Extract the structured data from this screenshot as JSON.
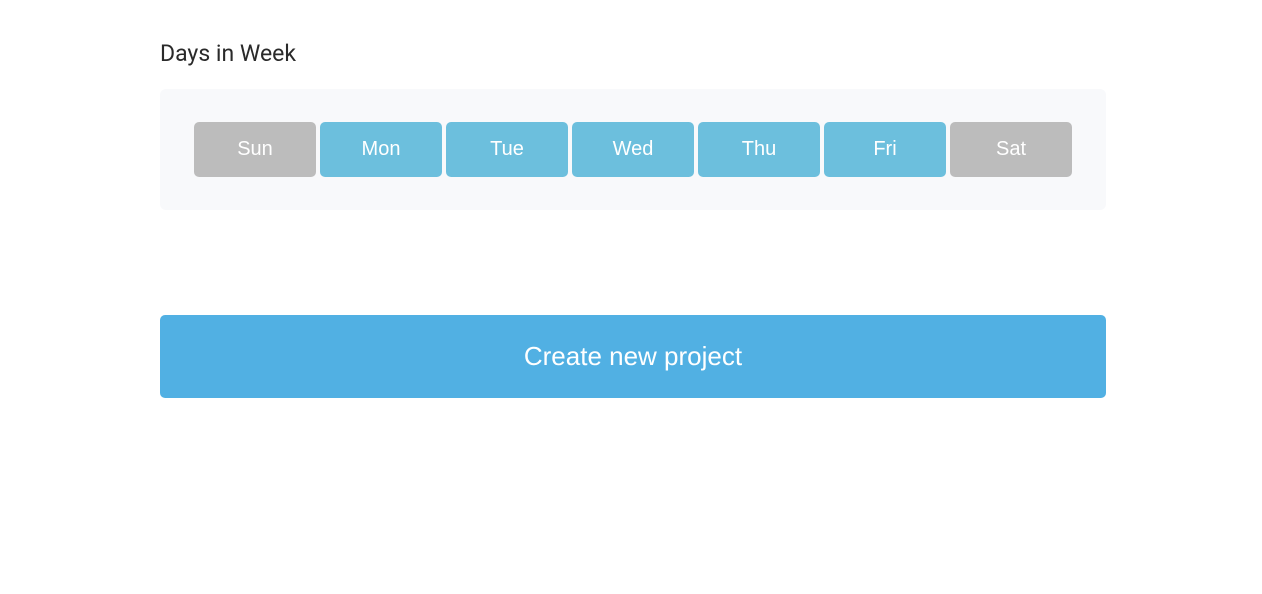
{
  "section": {
    "title": "Days in Week",
    "days": [
      {
        "label": "Sun",
        "active": false
      },
      {
        "label": "Mon",
        "active": true
      },
      {
        "label": "Tue",
        "active": true
      },
      {
        "label": "Wed",
        "active": true
      },
      {
        "label": "Thu",
        "active": true
      },
      {
        "label": "Fri",
        "active": true
      },
      {
        "label": "Sat",
        "active": false
      }
    ]
  },
  "submit": {
    "label": "Create new project"
  },
  "colors": {
    "day_active": "#6cbfdd",
    "day_inactive": "#bcbcbc",
    "submit": "#51b0e3",
    "panel_bg": "#f8f9fb",
    "title": "#2a2a2a"
  }
}
